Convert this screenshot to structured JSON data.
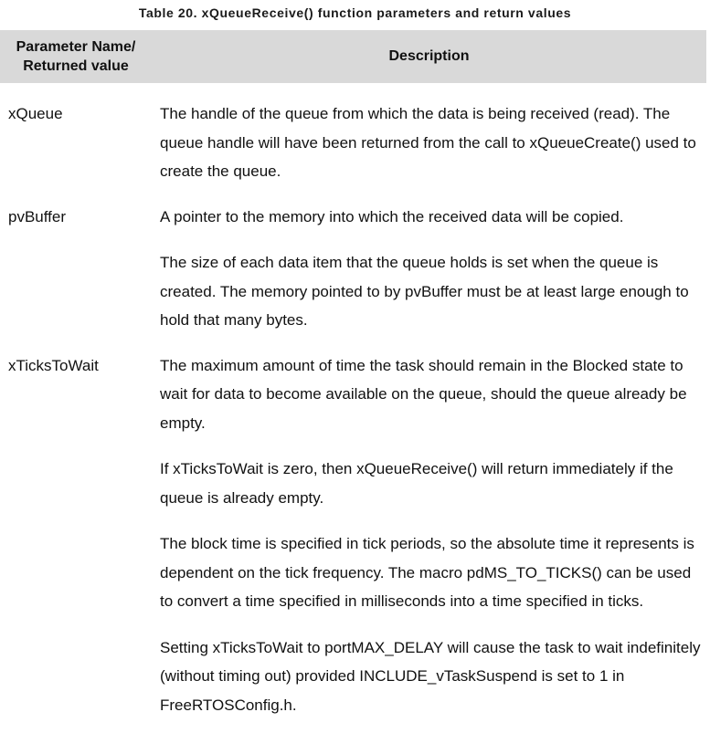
{
  "table": {
    "caption": "Table 20.  xQueueReceive() function parameters and return values",
    "header": {
      "col1_line1": "Parameter Name/",
      "col1_line2": "Returned value",
      "col2": "Description"
    },
    "rows": [
      {
        "param": "xQueue",
        "paragraphs": [
          "The handle of the queue from which the data is being received (read). The queue handle will have been returned from the call to xQueueCreate() used to create the queue."
        ]
      },
      {
        "param": "pvBuffer",
        "paragraphs": [
          "A pointer to the memory into which the received data will be copied.",
          "The size of each data item that the queue holds is set when the queue is created.  The memory pointed to by pvBuffer must be at least large enough to hold that many bytes."
        ]
      },
      {
        "param": "xTicksToWait",
        "paragraphs": [
          "The maximum amount of time the task should remain in the Blocked state to wait for data to become available on the queue, should the queue already be empty.",
          "If xTicksToWait is zero, then xQueueReceive() will return immediately if the queue is already empty.",
          "The block time is specified in tick periods, so the absolute time it represents is dependent on the tick frequency.  The macro pdMS_TO_TICKS() can be used to convert a time specified in milliseconds into a time specified in ticks.",
          "Setting xTicksToWait to portMAX_DELAY will cause the task to wait indefinitely (without timing out) provided INCLUDE_vTaskSuspend is set to 1 in FreeRTOSConfig.h."
        ]
      }
    ]
  }
}
